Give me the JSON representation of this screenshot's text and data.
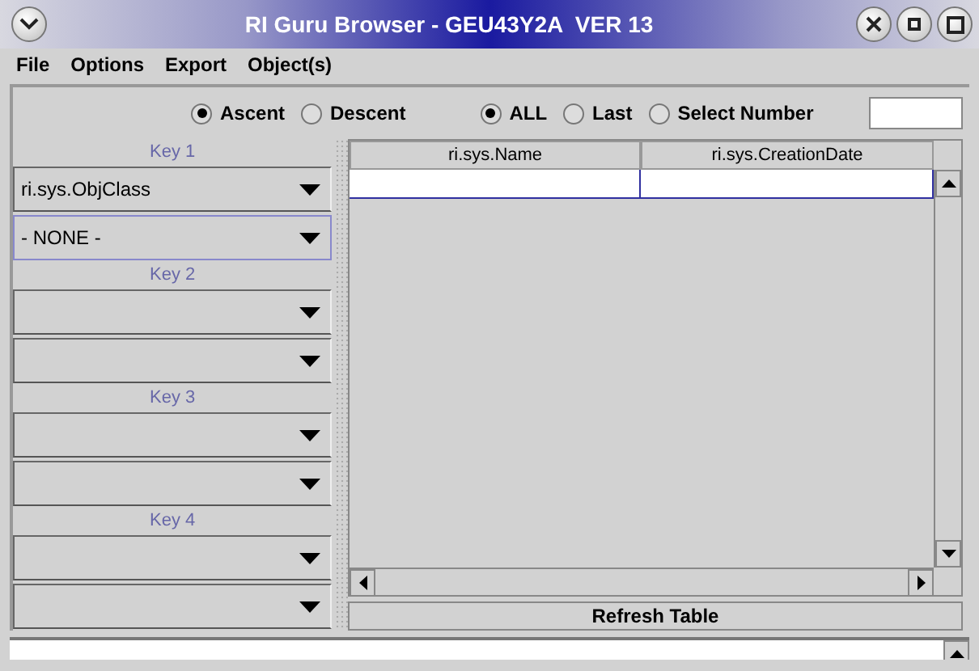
{
  "window": {
    "title": "RI Guru Browser - GEU43Y2A  VER 13"
  },
  "menu": [
    "File",
    "Options",
    "Export",
    "Object(s)"
  ],
  "sort_order": [
    {
      "label": "Ascent",
      "selected": true
    },
    {
      "label": "Descent",
      "selected": false
    }
  ],
  "range": [
    {
      "label": "ALL",
      "selected": true
    },
    {
      "label": "Last",
      "selected": false
    },
    {
      "label": "Select Number",
      "selected": false
    }
  ],
  "keys": [
    {
      "label": "Key 1",
      "dropdowns": [
        {
          "value": "ri.sys.ObjClass",
          "focused": false
        },
        {
          "value": "- NONE -",
          "focused": true
        }
      ]
    },
    {
      "label": "Key 2",
      "dropdowns": [
        {
          "focused": false
        },
        {
          "focused": false
        }
      ]
    },
    {
      "label": "Key 3",
      "dropdowns": [
        {
          "focused": false
        },
        {
          "focused": false
        }
      ]
    },
    {
      "label": "Key 4",
      "dropdowns": [
        {
          "focused": false
        },
        {
          "focused": false
        }
      ]
    }
  ],
  "table": {
    "columns": [
      "ri.sys.Name",
      "ri.sys.CreationDate"
    ]
  },
  "refresh_button": "Refresh Table"
}
